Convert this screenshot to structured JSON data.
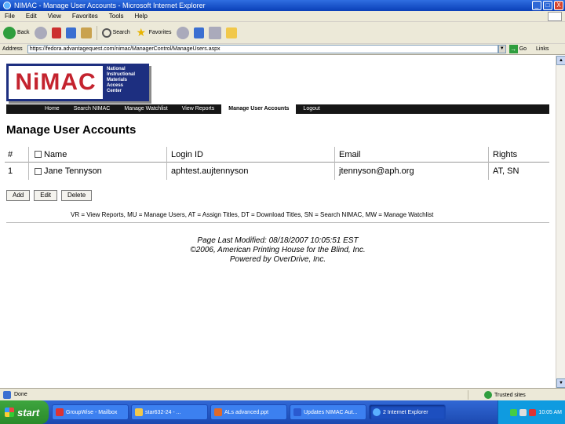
{
  "window": {
    "title": "NIMAC - Manage User Accounts - Microsoft Internet Explorer",
    "controls": [
      "_",
      "□",
      "X"
    ]
  },
  "menu": [
    "File",
    "Edit",
    "View",
    "Favorites",
    "Tools",
    "Help"
  ],
  "toolbar": {
    "back": "Back",
    "search": "Search",
    "favorites": "Favorites"
  },
  "address": {
    "label": "Address",
    "url": "https://fedora.advantagequest.com/nimac/ManagerControl/ManageUsers.aspx",
    "go": "Go",
    "links": "Links"
  },
  "logo": {
    "text": "NiMAC",
    "side": [
      "National",
      "Instructional",
      "Materials",
      "Access",
      "Center"
    ]
  },
  "nav": [
    "Home",
    "Search NIMAC",
    "Manage Watchlist",
    "View Reports",
    "Manage User Accounts",
    "Logout"
  ],
  "page": {
    "heading": "Manage User Accounts"
  },
  "table": {
    "headers": {
      "num": "#",
      "name": "Name",
      "login": "Login ID",
      "email": "Email",
      "rights": "Rights"
    },
    "rows": [
      {
        "num": "1",
        "name": "Jane Tennyson",
        "login": "aphtest.aujtennyson",
        "email": "jtennyson@aph.org",
        "rights": "AT, SN"
      }
    ]
  },
  "buttons": {
    "add": "Add",
    "edit": "Edit",
    "delete": "Delete"
  },
  "legend": "VR = View Reports, MU = Manage Users, AT = Assign Titles, DT = Download Titles, SN = Search NIMAC, MW = Manage Watchlist",
  "footer": {
    "modified": "Page Last Modified: 08/18/2007 10:05:51 EST",
    "copyright": "©2006, American Printing House for the Blind, Inc.",
    "powered": "Powered by OverDrive, Inc."
  },
  "status": {
    "text": "Done",
    "zone": "Trusted sites"
  },
  "taskbar": {
    "start": "start",
    "tasks": [
      "GroupWise - Mailbox",
      "star632-24 - ...",
      "ALs advanced.ppt",
      "Updates NIMAC Aut...",
      "2 Internet Explorer"
    ],
    "clock": "10:05 AM"
  },
  "colors": {
    "logo_red": "#c4232e",
    "logo_navy": "#1d2f80",
    "nav_bg": "#161616",
    "taskbar_blue": "#1c49b0",
    "start_green": "#2a8a2a"
  }
}
